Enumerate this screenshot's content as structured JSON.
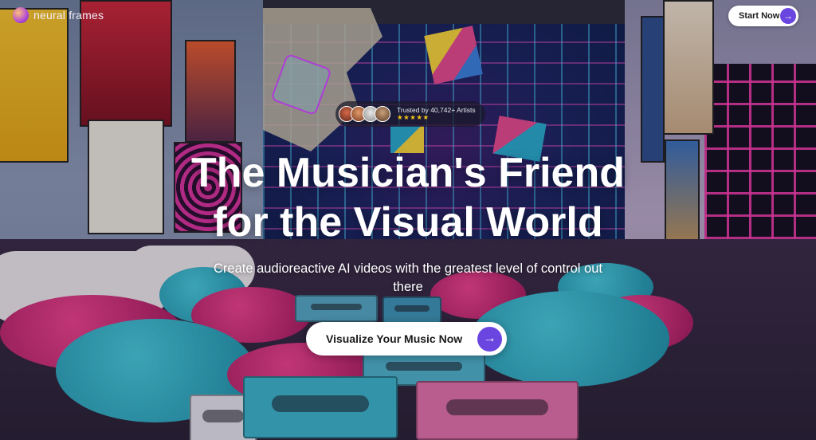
{
  "brand": {
    "name": "neural frames",
    "logo_icon": "neural-frames-logo"
  },
  "header": {
    "cta_label": "Start Now",
    "cta_icon": "arrow-right-icon"
  },
  "trust": {
    "label": "Trusted by 40,742+ Artists",
    "stars": "★★★★★",
    "rating_stars": 5,
    "avatar_count": 4
  },
  "hero": {
    "title_line1": "The Musician's Friend",
    "title_line2": "for the Visual World",
    "subtitle": "Create audioreactive AI videos with the greatest level of control out there",
    "cta_label": "Visualize Your Music Now",
    "cta_icon": "arrow-right-icon"
  },
  "colors": {
    "accent": "#6a45e0",
    "button_bg": "#ffffff",
    "text": "#ffffff",
    "star": "#f5c518"
  }
}
